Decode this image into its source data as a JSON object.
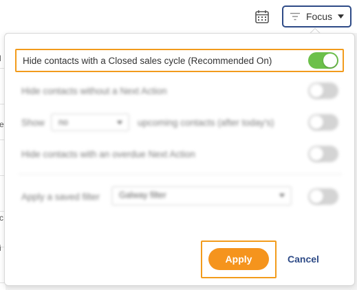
{
  "topbar": {
    "calendar_icon": "calendar-icon",
    "focus_button": {
      "label": "Focus",
      "icon": "filter-lines-icon",
      "caret": "caret-down-icon",
      "border_color": "#2d4a86"
    }
  },
  "background_list": {
    "fragments": [
      "l",
      "e",
      "c",
      "i"
    ]
  },
  "panel": {
    "options": [
      {
        "label": "Hide contacts with a Closed sales cycle (Recommended On)",
        "enabled": true,
        "highlighted": true
      },
      {
        "label": "Hide contacts without a Next Action",
        "enabled": false
      },
      {
        "prefix": "Show",
        "select_value": "no",
        "suffix": "upcoming contacts (after today's)",
        "enabled": false
      },
      {
        "label": "Hide contacts with an overdue Next Action",
        "enabled": false
      },
      {
        "label": "Apply a saved filter",
        "select_value": "Galway filter",
        "enabled": false
      }
    ],
    "apply_label": "Apply",
    "cancel_label": "Cancel"
  },
  "colors": {
    "accent": "#f5941d",
    "highlight_border": "#f29b1b",
    "toggle_on": "#6cc04a",
    "toggle_off": "#d4d4d4",
    "link": "#2d4a86"
  }
}
